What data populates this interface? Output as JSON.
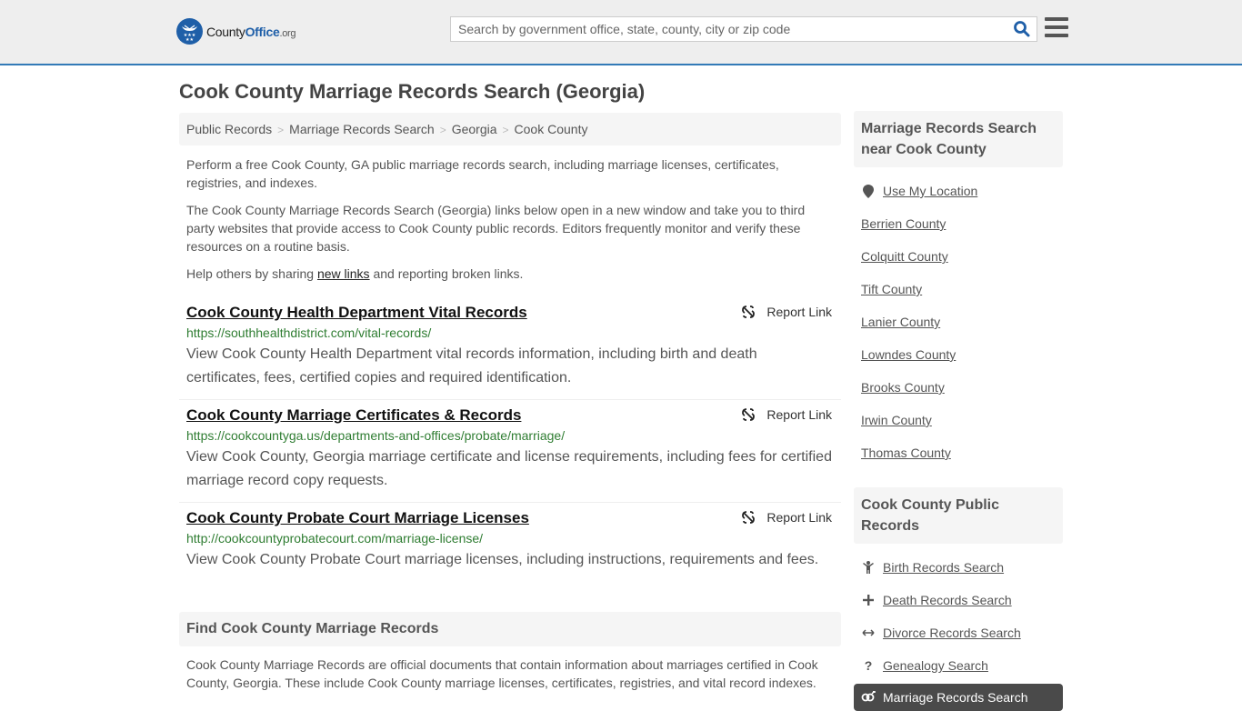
{
  "header": {
    "logo": {
      "county": "County",
      "office": "Office",
      "org": ".org"
    },
    "search": {
      "placeholder": "Search by government office, state, county, city or zip code",
      "value": ""
    },
    "icons": {
      "search": "search-icon",
      "menu": "hamburger-menu-icon"
    }
  },
  "page": {
    "title": "Cook County Marriage Records Search (Georgia)"
  },
  "breadcrumb": [
    "Public Records",
    "Marriage Records Search",
    "Georgia",
    "Cook County"
  ],
  "intro": {
    "p1": "Perform a free Cook County, GA public marriage records search, including marriage licenses, certificates, registries, and indexes.",
    "p2": "The Cook County Marriage Records Search (Georgia) links below open in a new window and take you to third party websites that provide access to Cook County public records. Editors frequently monitor and verify these resources on a routine basis.",
    "p3_before": "Help others by sharing ",
    "p3_link": "new links",
    "p3_after": " and reporting broken links."
  },
  "results": [
    {
      "title": "Cook County Health Department Vital Records",
      "url": "https://southhealthdistrict.com/vital-records/",
      "description": "View Cook County Health Department vital records information, including birth and death certificates, fees, certified copies and required identification.",
      "report_label": "Report Link"
    },
    {
      "title": "Cook County Marriage Certificates & Records",
      "url": "https://cookcountyga.us/departments-and-offices/probate/marriage/",
      "description": "View Cook County, Georgia marriage certificate and license requirements, including fees for certified marriage record copy requests.",
      "report_label": "Report Link"
    },
    {
      "title": "Cook County Probate Court Marriage Licenses",
      "url": "http://cookcountyprobatecourt.com/marriage-license/",
      "description": "View Cook County Probate Court marriage licenses, including instructions, requirements and fees.",
      "report_label": "Report Link"
    }
  ],
  "find": {
    "heading": "Find Cook County Marriage Records",
    "text": "Cook County Marriage Records are official documents that contain information about marriages certified in Cook County, Georgia. These include Cook County marriage licenses, certificates, registries, and vital record indexes."
  },
  "sidebar": {
    "nearby": {
      "heading": "Marriage Records Search near Cook County",
      "use_location": "Use My Location",
      "counties": [
        "Berrien County",
        "Colquitt County",
        "Tift County",
        "Lanier County",
        "Lowndes County",
        "Brooks County",
        "Irwin County",
        "Thomas County"
      ]
    },
    "public_records": {
      "heading": "Cook County Public Records",
      "items": [
        {
          "label": "Birth Records Search",
          "icon": "child-icon"
        },
        {
          "label": "Death Records Search",
          "icon": "cross-icon"
        },
        {
          "label": "Divorce Records Search",
          "icon": "arrows-horizontal-icon"
        },
        {
          "label": "Genealogy Search",
          "icon": "question-icon"
        }
      ],
      "active": {
        "label": "Marriage Records Search",
        "icon": "genderless-rings-icon"
      }
    }
  },
  "colors": {
    "accent": "#337ab7",
    "url_green": "#2f7d32",
    "active_bg": "#4a4a4a",
    "logo_blue": "#1f5fa8"
  }
}
